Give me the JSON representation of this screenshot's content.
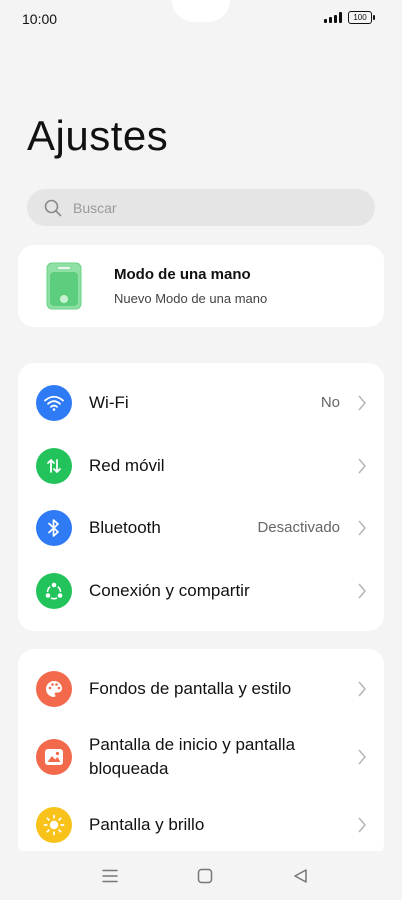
{
  "status": {
    "time": "10:00",
    "battery": "100"
  },
  "page": {
    "title": "Ajustes"
  },
  "search": {
    "placeholder": "Buscar"
  },
  "one_hand": {
    "title": "Modo de una mano",
    "subtitle": "Nuevo Modo de una mano"
  },
  "connectivity": [
    {
      "label": "Wi-Fi",
      "value": "No",
      "icon": "wifi-icon",
      "color": "#2f7bf5"
    },
    {
      "label": "Red móvil",
      "value": "",
      "icon": "mobile-data-icon",
      "color": "#22c35a"
    },
    {
      "label": "Bluetooth",
      "value": "Desactivado",
      "icon": "bluetooth-icon",
      "color": "#2f7bf5"
    },
    {
      "label": "Conexión y compartir",
      "value": "",
      "icon": "share-icon",
      "color": "#22c35a"
    }
  ],
  "display": [
    {
      "label": "Fondos de pantalla y estilo",
      "icon": "palette-icon",
      "color": "#f26a4b"
    },
    {
      "label_line1": "Pantalla de inicio y pantalla",
      "label_line2": "bloqueada",
      "icon": "image-icon",
      "color": "#f26a4b"
    },
    {
      "label": "Pantalla y brillo",
      "icon": "brightness-icon",
      "color": "#f8c21a"
    }
  ],
  "colors": {
    "background": "#f4f4f4",
    "card": "#ffffff",
    "accent_green": "#5dce7d"
  }
}
